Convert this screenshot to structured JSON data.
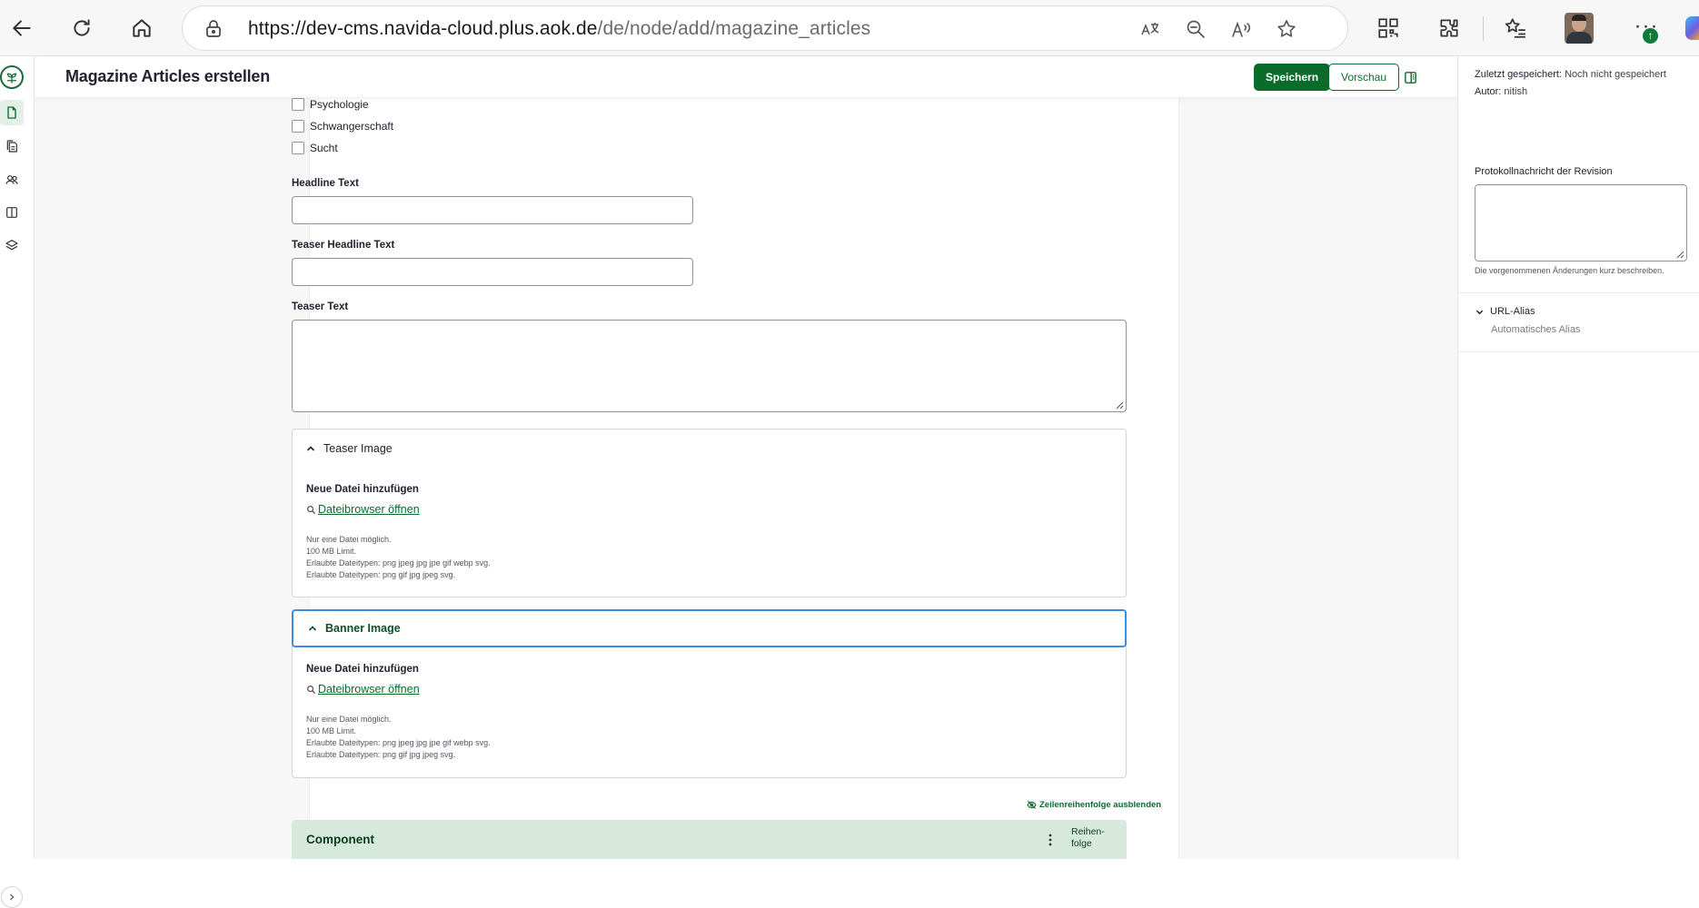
{
  "browser": {
    "url_host": "https://dev-cms.navida-cloud.plus.aok.de",
    "url_path": "/de/node/add/magazine_articles",
    "icons": [
      "back-arrow-icon",
      "refresh-icon",
      "home-icon",
      "lock-icon",
      "translate-icon",
      "zoom-out-icon",
      "read-aloud-icon",
      "favorite-star-icon",
      "qr-code-icon",
      "extensions-icon",
      "favorites-list-icon",
      "profile-avatar",
      "more-menu-icon",
      "copilot-icon"
    ],
    "more_label": "···",
    "update_badge": "↑"
  },
  "toolbar": {
    "icons": [
      "brand-logo-icon",
      "content-add-icon",
      "content-list-icon",
      "people-icon",
      "layout-icon",
      "layers-icon",
      "expand-toolbar-icon"
    ]
  },
  "header": {
    "title": "Magazine Articles erstellen",
    "save_label": "Speichern",
    "preview_label": "Vorschau"
  },
  "form": {
    "topics": [
      "Psychologie",
      "Schwangerschaft",
      "Sucht"
    ],
    "headline_label": "Headline Text",
    "teaser_headline_label": "Teaser Headline Text",
    "teaser_text_label": "Teaser Text",
    "teaser_image": {
      "title": "Teaser Image",
      "add_label": "Neue Datei hinzufügen",
      "browse_label": "Dateibrowser öffnen",
      "help": [
        "Nur eine Datei möglich.",
        "100 MB Limit.",
        "Erlaubte Dateitypen: png jpeg jpg jpe gif webp svg.",
        "Erlaubte Dateitypen: png gif jpg jpeg svg."
      ]
    },
    "banner_image": {
      "title": "Banner Image",
      "add_label": "Neue Datei hinzufügen",
      "browse_label": "Dateibrowser öffnen",
      "help": [
        "Nur eine Datei möglich.",
        "100 MB Limit.",
        "Erlaubte Dateitypen: png jpeg jpg jpe gif webp svg.",
        "Erlaubte Dateitypen: png gif jpg jpeg svg."
      ]
    },
    "row_order_label": "Zeilenreihenfolge ausblenden",
    "component": {
      "title": "Component",
      "reorder_line1": "Reihen-",
      "reorder_line2": "folge"
    }
  },
  "meta": {
    "saved_label": "Zuletzt gespeichert:",
    "saved_value": "Noch nicht gespeichert",
    "author_label": "Autor:",
    "author_value": "nitish",
    "revision_label": "Protokollnachricht der Revision",
    "revision_help": "Die vorgenommenen Änderungen kurz beschreiben.",
    "url_alias_title": "URL-Alias",
    "url_alias_value": "Automatisches Alias"
  },
  "colors": {
    "brand_green": "#0b6b2b",
    "component_bg": "#d6e9dc",
    "focus_blue": "#3b8ee3"
  }
}
